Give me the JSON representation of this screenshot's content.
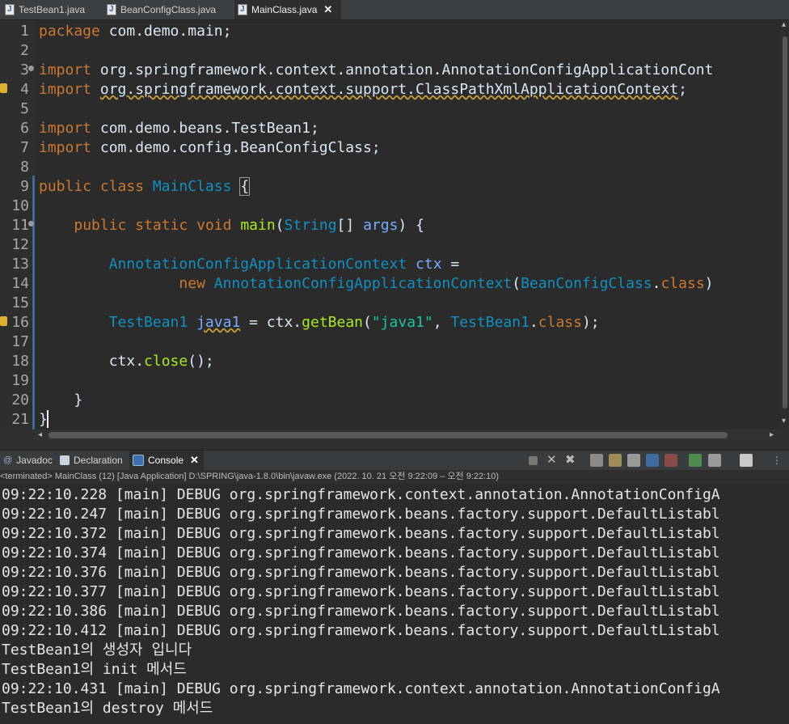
{
  "editor_tabs": [
    {
      "label": "TestBean1.java"
    },
    {
      "label": "BeanConfigClass.java"
    },
    {
      "label": "MainClass.java"
    }
  ],
  "tab_close_glyph": "✕",
  "code_lines": [
    {
      "num": "1",
      "segments": [
        {
          "t": "package",
          "c": "kw"
        },
        {
          "t": " com.demo.main;"
        }
      ]
    },
    {
      "num": "2",
      "segments": []
    },
    {
      "num": "3",
      "segments": [
        {
          "t": "import",
          "c": "kw"
        },
        {
          "t": " org.springframework.context.annotation.AnnotationConfigApplicationCont"
        }
      ]
    },
    {
      "num": "4",
      "segments": [
        {
          "t": "import",
          "c": "kw"
        },
        {
          "t": " "
        },
        {
          "t": "org.springframework.context.support.ClassPathXmlApplicationContext",
          "c": "wavy"
        },
        {
          "t": ";"
        }
      ]
    },
    {
      "num": "5",
      "segments": []
    },
    {
      "num": "6",
      "segments": [
        {
          "t": "import",
          "c": "kw"
        },
        {
          "t": " com.demo.beans.TestBean1;"
        }
      ]
    },
    {
      "num": "7",
      "segments": [
        {
          "t": "import",
          "c": "kw"
        },
        {
          "t": " com.demo.config.BeanConfigClass;"
        }
      ]
    },
    {
      "num": "8",
      "segments": []
    },
    {
      "num": "9",
      "segments": [
        {
          "t": "public",
          "c": "kw"
        },
        {
          "t": " "
        },
        {
          "t": "class",
          "c": "kw"
        },
        {
          "t": " "
        },
        {
          "t": "MainClass",
          "c": "typ"
        },
        {
          "t": " "
        },
        {
          "t": "{",
          "c": "bracket"
        }
      ]
    },
    {
      "num": "10",
      "segments": []
    },
    {
      "num": "11",
      "segments": [
        {
          "t": "    "
        },
        {
          "t": "public",
          "c": "kw"
        },
        {
          "t": " "
        },
        {
          "t": "static",
          "c": "kw"
        },
        {
          "t": " "
        },
        {
          "t": "void",
          "c": "kw"
        },
        {
          "t": " "
        },
        {
          "t": "main",
          "c": "mth"
        },
        {
          "t": "("
        },
        {
          "t": "String",
          "c": "typ"
        },
        {
          "t": "[] "
        },
        {
          "t": "args",
          "c": "var"
        },
        {
          "t": ") {"
        }
      ]
    },
    {
      "num": "12",
      "segments": []
    },
    {
      "num": "13",
      "segments": [
        {
          "t": "        "
        },
        {
          "t": "AnnotationConfigApplicationContext",
          "c": "typ"
        },
        {
          "t": " "
        },
        {
          "t": "ctx",
          "c": "var"
        },
        {
          "t": " ="
        }
      ]
    },
    {
      "num": "14",
      "segments": [
        {
          "t": "                "
        },
        {
          "t": "new",
          "c": "kw"
        },
        {
          "t": " "
        },
        {
          "t": "AnnotationConfigApplicationContext",
          "c": "typ"
        },
        {
          "t": "("
        },
        {
          "t": "BeanConfigClass",
          "c": "typ"
        },
        {
          "t": "."
        },
        {
          "t": "class",
          "c": "kw"
        },
        {
          "t": ")"
        }
      ]
    },
    {
      "num": "15",
      "segments": []
    },
    {
      "num": "16",
      "segments": [
        {
          "t": "        "
        },
        {
          "t": "TestBean1",
          "c": "typ"
        },
        {
          "t": " "
        },
        {
          "t": "java1",
          "c": "var wavy"
        },
        {
          "t": " = ctx."
        },
        {
          "t": "getBean",
          "c": "mth"
        },
        {
          "t": "("
        },
        {
          "t": "\"java1\"",
          "c": "str"
        },
        {
          "t": ", "
        },
        {
          "t": "TestBean1",
          "c": "typ"
        },
        {
          "t": "."
        },
        {
          "t": "class",
          "c": "kw"
        },
        {
          "t": ");"
        }
      ]
    },
    {
      "num": "17",
      "segments": []
    },
    {
      "num": "18",
      "segments": [
        {
          "t": "        ctx."
        },
        {
          "t": "close",
          "c": "mth"
        },
        {
          "t": "();"
        }
      ]
    },
    {
      "num": "19",
      "segments": []
    },
    {
      "num": "20",
      "segments": [
        {
          "t": "    }"
        }
      ]
    },
    {
      "num": "21",
      "segments": [
        {
          "t": "}"
        }
      ]
    }
  ],
  "panel_tabs": [
    {
      "label": "Javadoc"
    },
    {
      "label": "Declaration"
    },
    {
      "label": "Console"
    }
  ],
  "console_status": "<terminated> MainClass (12) [Java Application] D:\\SPRING\\java-1.8.0\\bin\\javaw.exe  (2022. 10. 21 오전 9:22:09 – 오전 9:22:10)",
  "console_lines": [
    "09:22:10.228 [main] DEBUG org.springframework.context.annotation.AnnotationConfigA",
    "09:22:10.247 [main] DEBUG org.springframework.beans.factory.support.DefaultListabl",
    "09:22:10.372 [main] DEBUG org.springframework.beans.factory.support.DefaultListabl",
    "09:22:10.374 [main] DEBUG org.springframework.beans.factory.support.DefaultListabl",
    "09:22:10.376 [main] DEBUG org.springframework.beans.factory.support.DefaultListabl",
    "09:22:10.377 [main] DEBUG org.springframework.beans.factory.support.DefaultListabl",
    "09:22:10.386 [main] DEBUG org.springframework.beans.factory.support.DefaultListabl",
    "09:22:10.412 [main] DEBUG org.springframework.beans.factory.support.DefaultListabl",
    "TestBean1의 생성자 입니다",
    "TestBean1의 init 메서드",
    "09:22:10.431 [main] DEBUG org.springframework.context.annotation.AnnotationConfigA",
    "TestBean1의 destroy 메서드"
  ],
  "colors": {
    "keyword": "#cc7832",
    "type": "#1290c3",
    "variable": "#79abff",
    "string": "#17c6a3",
    "method": "#a7ec21",
    "warning": "#e0b030"
  }
}
